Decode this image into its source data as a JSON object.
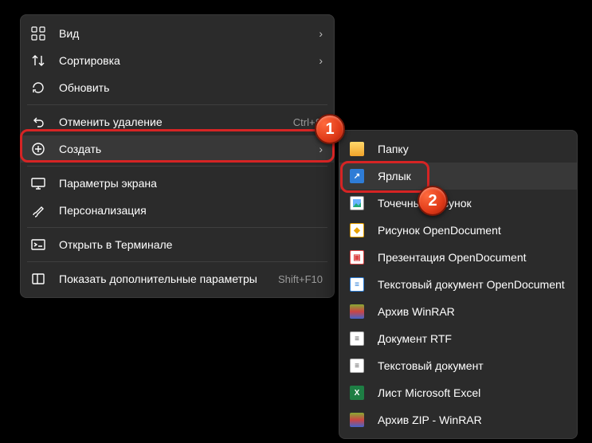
{
  "main_menu": {
    "items": [
      {
        "label": "Вид"
      },
      {
        "label": "Сортировка"
      },
      {
        "label": "Обновить"
      },
      {
        "label": "Отменить удаление",
        "shortcut": "Ctrl+Я"
      },
      {
        "label": "Создать"
      },
      {
        "label": "Параметры экрана"
      },
      {
        "label": "Персонализация"
      },
      {
        "label": "Открыть в Терминале"
      },
      {
        "label": "Показать дополнительные параметры",
        "shortcut": "Shift+F10"
      }
    ]
  },
  "sub_menu": {
    "items": [
      {
        "label": "Папку"
      },
      {
        "label": "Ярлык"
      },
      {
        "label": "Точечный рисунок"
      },
      {
        "label": "Рисунок OpenDocument"
      },
      {
        "label": "Презентация OpenDocument"
      },
      {
        "label": "Текстовый документ OpenDocument"
      },
      {
        "label": "Архив WinRAR"
      },
      {
        "label": "Документ RTF"
      },
      {
        "label": "Текстовый документ"
      },
      {
        "label": "Лист Microsoft Excel"
      },
      {
        "label": "Архив ZIP - WinRAR"
      }
    ]
  },
  "badges": {
    "one": "1",
    "two": "2"
  }
}
